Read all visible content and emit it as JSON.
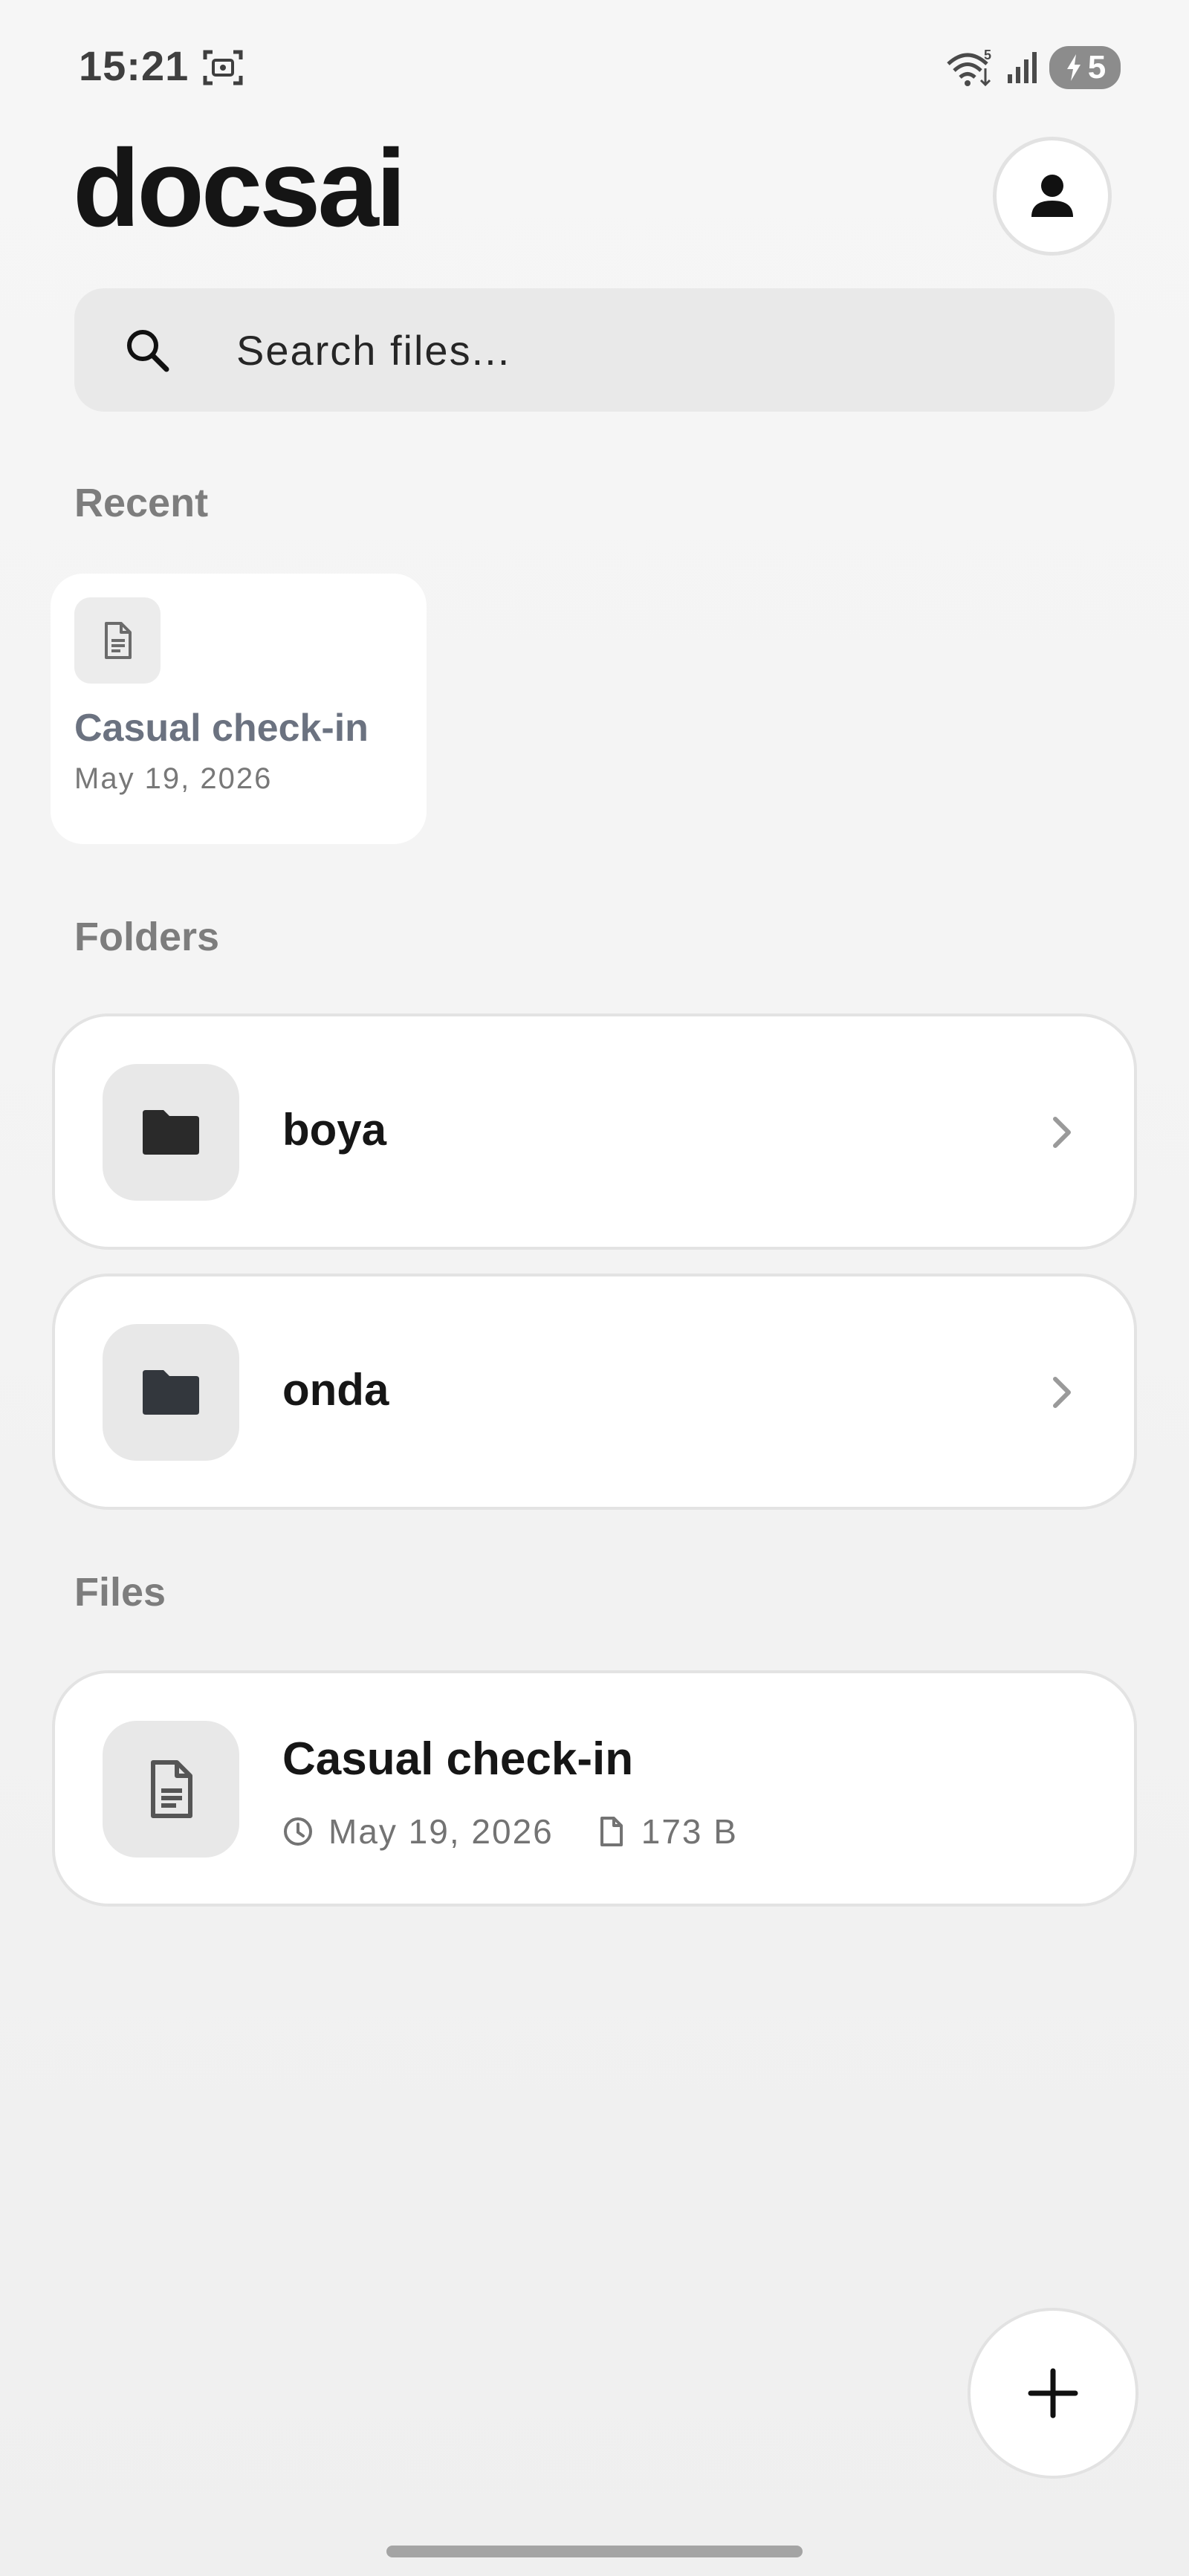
{
  "status_bar": {
    "time": "15:21",
    "battery_level": "5",
    "icons": [
      "screen-record-icon",
      "wifi-icon",
      "signal-icon",
      "battery-charging-icon"
    ]
  },
  "header": {
    "title": "docsai",
    "profile_icon": "person-icon"
  },
  "search": {
    "placeholder": "Search files...",
    "value": "",
    "icon": "search-icon"
  },
  "sections": {
    "recent": "Recent",
    "folders": "Folders",
    "files": "Files"
  },
  "recent": [
    {
      "name": "Casual check-in",
      "date": "May 19, 2026",
      "icon": "document-icon"
    }
  ],
  "folders": [
    {
      "name": "boya",
      "icon": "folder-icon"
    },
    {
      "name": "onda",
      "icon": "folder-icon"
    }
  ],
  "files": [
    {
      "name": "Casual check-in",
      "date": "May 19, 2026",
      "size": "173 B",
      "icon": "document-icon"
    }
  ],
  "fab": {
    "icon": "plus-icon"
  },
  "colors": {
    "background": "#f3f3f3",
    "card": "#ffffff",
    "icon_box": "#e8e8e8",
    "section_label": "#7d7d7d",
    "primary_text": "#161616"
  }
}
